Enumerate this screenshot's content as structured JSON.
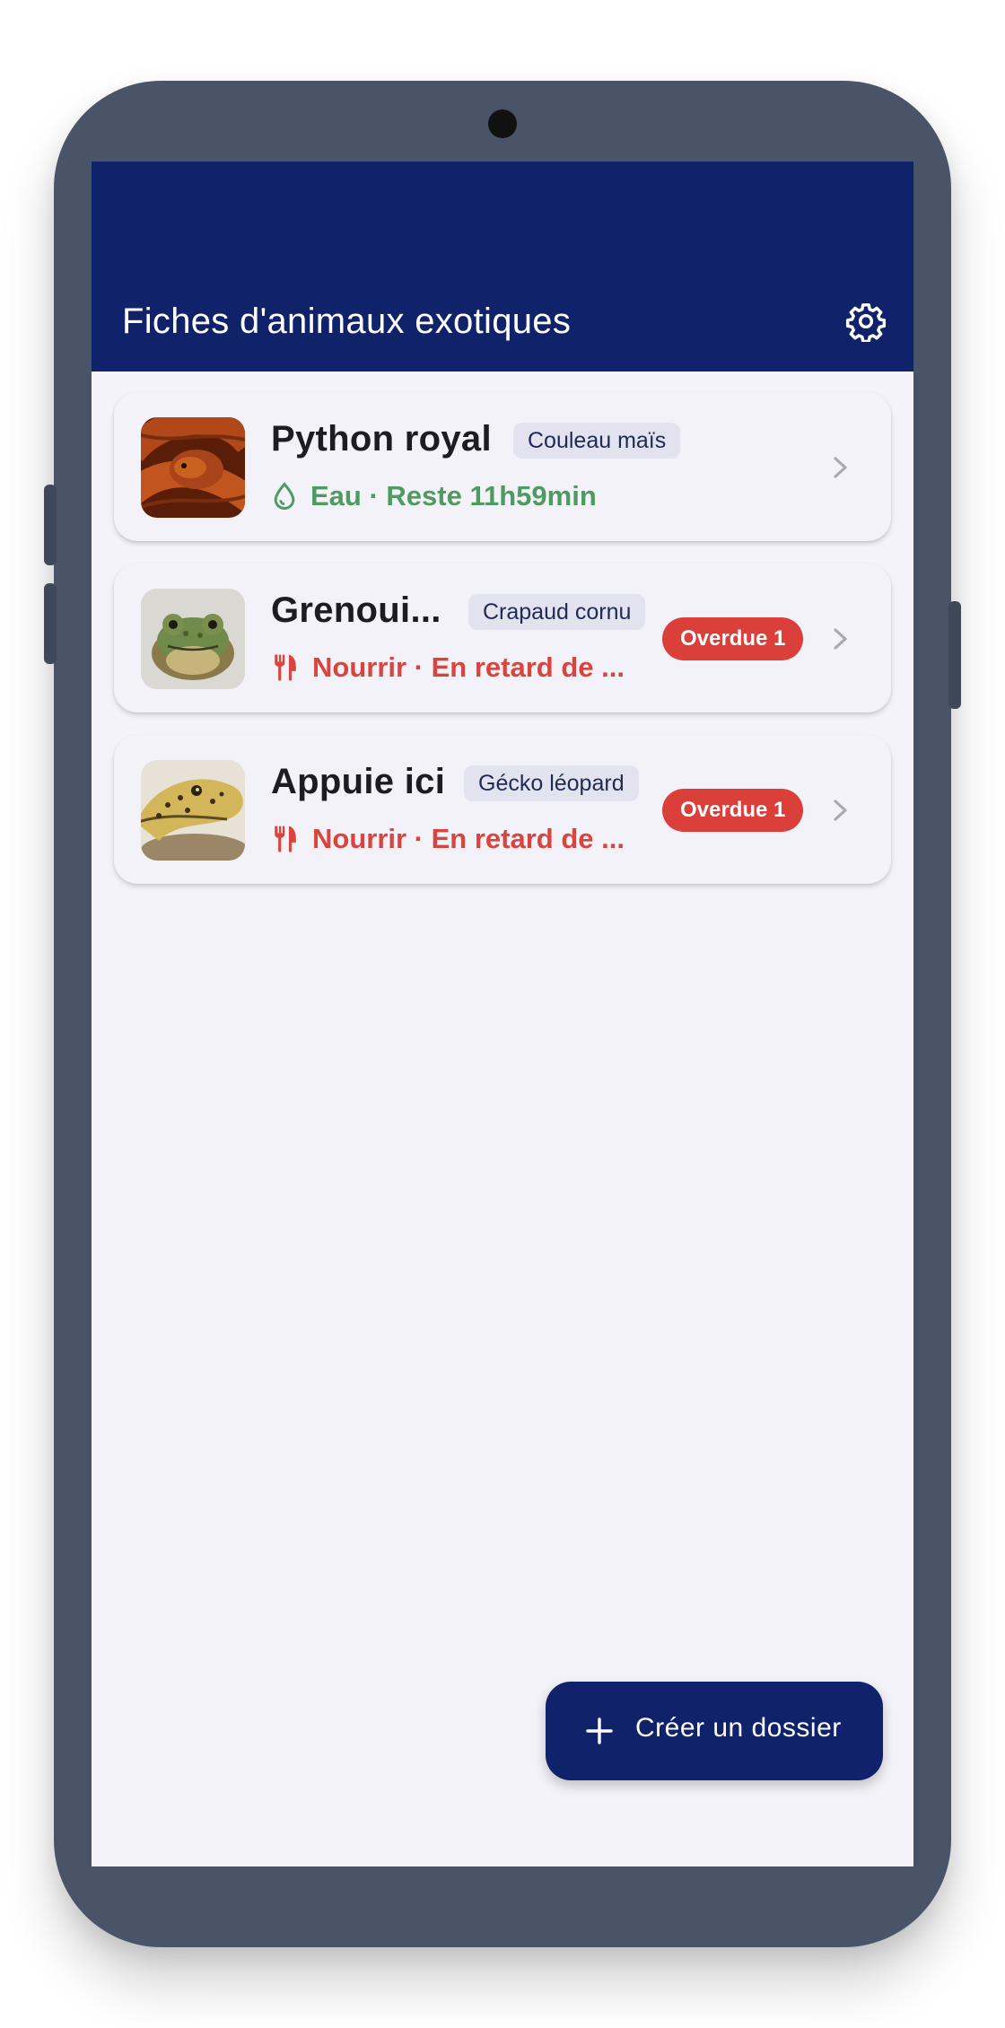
{
  "app": {
    "title": "Fiches d'animaux exotiques"
  },
  "header": {
    "settings_icon": "gear-icon"
  },
  "animals": [
    {
      "name": "Python royal",
      "species": "Couleau maïs",
      "status_icon": "water-drop-icon",
      "status": "Eau · Reste 11h59min",
      "status_color": "#4f9a61",
      "badge": null
    },
    {
      "name": "Grenoui...",
      "species": "Crapaud cornu",
      "status_icon": "fork-knife-icon",
      "status": "Nourrir · En retard de ...",
      "status_color": "#d9453e",
      "badge": "Overdue 1"
    },
    {
      "name": "Appuie ici",
      "species": "Gécko léopard",
      "status_icon": "fork-knife-icon",
      "status": "Nourrir · En retard de ...",
      "status_color": "#d9453e",
      "badge": "Overdue 1"
    }
  ],
  "fab": {
    "icon": "plus-icon",
    "label": "Créer un dossier"
  },
  "colors": {
    "primary": "#10226a",
    "background": "#f4f3f9",
    "ok": "#4f9a61",
    "overdue": "#db3f3a"
  }
}
